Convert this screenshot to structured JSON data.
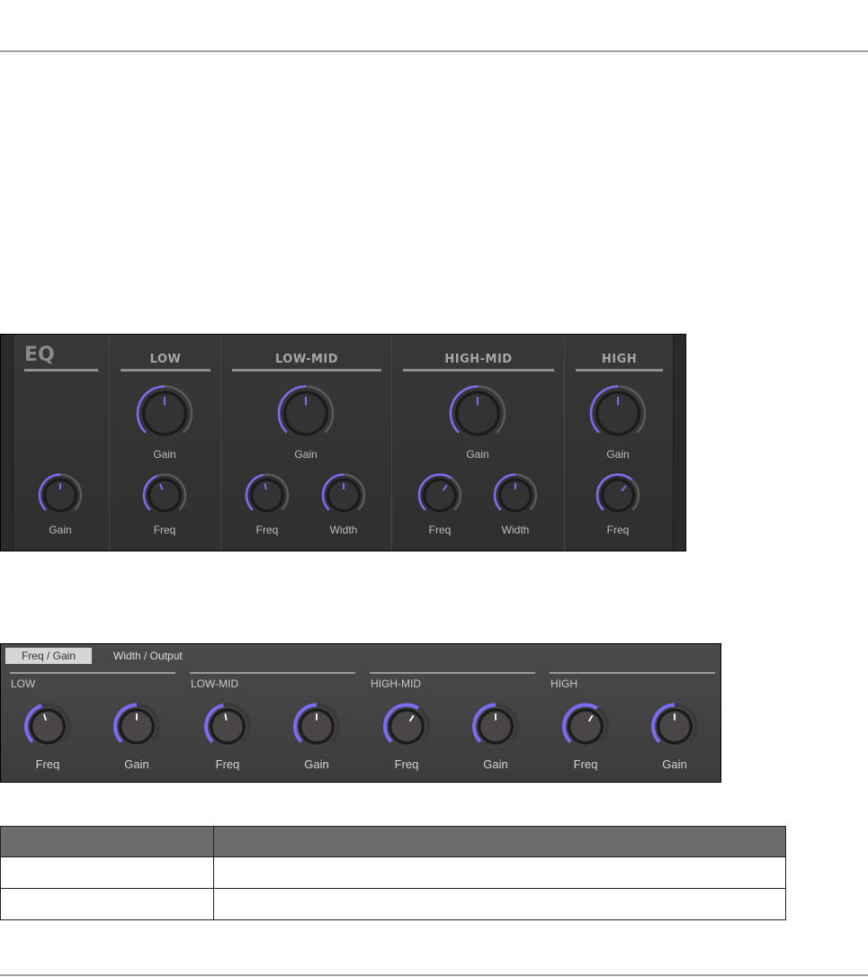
{
  "accent": "#7b6cf6",
  "eq_panel": {
    "title": "EQ",
    "master": {
      "label": "Gain",
      "value": 0.5
    },
    "sections": [
      {
        "name": "LOW",
        "knobs": [
          {
            "label": "Gain",
            "value": 0.5
          },
          {
            "label": "Freq",
            "value": 0.42
          }
        ]
      },
      {
        "name": "LOW-MID",
        "knobs": [
          {
            "label": "Gain",
            "value": 0.5
          },
          {
            "label": "Freq",
            "value": 0.46
          },
          {
            "label": "Width",
            "value": 0.5
          }
        ]
      },
      {
        "name": "HIGH-MID",
        "knobs": [
          {
            "label": "Gain",
            "value": 0.5
          },
          {
            "label": "Freq",
            "value": 0.63
          },
          {
            "label": "Width",
            "value": 0.5
          }
        ]
      },
      {
        "name": "HIGH",
        "knobs": [
          {
            "label": "Gain",
            "value": 0.5
          },
          {
            "label": "Freq",
            "value": 0.65
          }
        ]
      }
    ]
  },
  "hw_panel": {
    "tabs": [
      {
        "label": "Freq / Gain",
        "active": true
      },
      {
        "label": "Width / Output",
        "active": false
      }
    ],
    "sections": [
      {
        "name": "LOW",
        "knobs": [
          {
            "label": "Freq",
            "value": 0.44
          },
          {
            "label": "Gain",
            "value": 0.5
          }
        ]
      },
      {
        "name": "LOW-MID",
        "knobs": [
          {
            "label": "Freq",
            "value": 0.46
          },
          {
            "label": "Gain",
            "value": 0.5
          }
        ]
      },
      {
        "name": "HIGH-MID",
        "knobs": [
          {
            "label": "Freq",
            "value": 0.62
          },
          {
            "label": "Gain",
            "value": 0.5
          }
        ]
      },
      {
        "name": "HIGH",
        "knobs": [
          {
            "label": "Freq",
            "value": 0.62
          },
          {
            "label": "Gain",
            "value": 0.5
          }
        ]
      }
    ]
  }
}
